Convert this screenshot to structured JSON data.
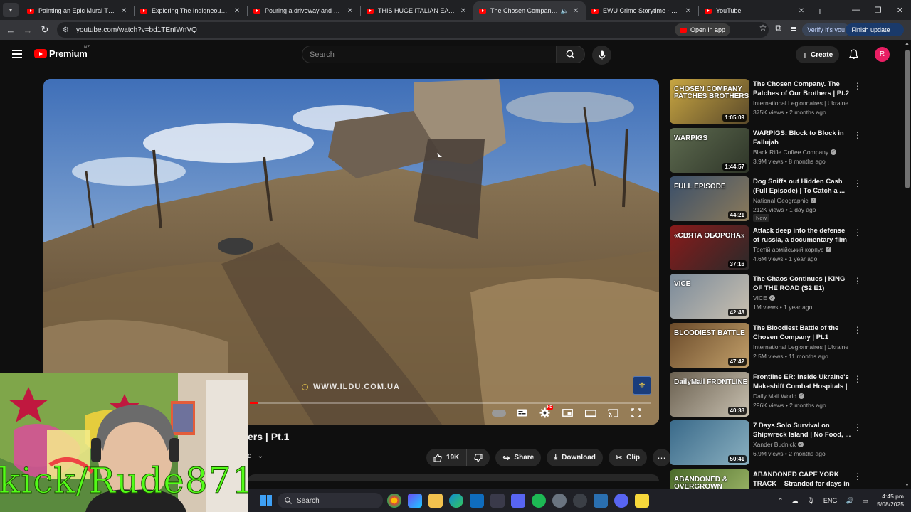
{
  "tabs": [
    {
      "label": "Painting an Epic Mural That Wi",
      "active": false
    },
    {
      "label": "Exploring The Indigneous Tribal",
      "active": false
    },
    {
      "label": "Pouring a driveway and WHAT",
      "active": false
    },
    {
      "label": "THIS HUGE ITALIAN EATING CH",
      "active": false
    },
    {
      "label": "The Chosen Company. The",
      "active": true
    },
    {
      "label": "EWU Crime Storytime - YouTub",
      "active": false
    },
    {
      "label": "YouTube",
      "active": false
    }
  ],
  "address": {
    "url": "youtube.com/watch?v=bd1TEnIWnVQ",
    "open_in_app": "Open in app",
    "verify": "Verify it's you",
    "finish_update": "Finish update"
  },
  "header": {
    "logo_text": "Premium",
    "country": "NZ",
    "search_placeholder": "Search",
    "create_label": "Create",
    "avatar_letter": "R"
  },
  "player": {
    "watermark": "WWW.ILDU.COM.UA",
    "progress": 0.02
  },
  "video": {
    "title_visible": "ers | Pt.1",
    "channel_tail": "d",
    "likes": "19K",
    "share_label": "Share",
    "download_label": "Download",
    "clip_label": "Clip"
  },
  "recommendations": [
    {
      "title": "The Chosen Company. The Patches of Our Brothers | Pt.2",
      "channel": "International Legionnaires | Ukraine",
      "verified": false,
      "meta": "375K views • 2 months ago",
      "duration": "1:05:09",
      "thumb_text": "CHOSEN COMPANY PATCHES BROTHERS",
      "badge": ""
    },
    {
      "title": "WARPIGS: Block to Block in Fallujah",
      "channel": "Black Rifle Coffee Company",
      "verified": true,
      "meta": "3.9M views • 8 months ago",
      "duration": "1:44:57",
      "thumb_text": "WARPIGS",
      "badge": ""
    },
    {
      "title": "Dog Sniffs out Hidden Cash (Full Episode) | To Catch a ...",
      "channel": "National Geographic",
      "verified": true,
      "meta": "212K views • 1 day ago",
      "duration": "44:21",
      "thumb_text": "FULL EPISODE",
      "badge": "New"
    },
    {
      "title": "Attack deep into the defense of russia, a documentary film ...",
      "channel": "Третій армійський корпус",
      "verified": true,
      "meta": "4.6M views • 1 year ago",
      "duration": "37:16",
      "thumb_text": "«СВЯТА ОБОРОНА»",
      "badge": ""
    },
    {
      "title": "The Chaos Continues | KING OF THE ROAD (S2 E1)",
      "channel": "VICE",
      "verified": true,
      "meta": "1M views • 1 year ago",
      "duration": "42:48",
      "thumb_text": "VICE",
      "badge": ""
    },
    {
      "title": "The Bloodiest Battle of the Chosen Company | Pt.1",
      "channel": "International Legionnaires | Ukraine",
      "verified": false,
      "meta": "2.5M views • 11 months ago",
      "duration": "47:42",
      "thumb_text": "BLOODIEST BATTLE",
      "badge": ""
    },
    {
      "title": "Frontline ER: Inside Ukraine's Makeshift Combat Hospitals | ...",
      "channel": "Daily Mail World",
      "verified": true,
      "meta": "296K views • 2 months ago",
      "duration": "40:38",
      "thumb_text": "DailyMail FRONTLINE",
      "badge": ""
    },
    {
      "title": "7 Days Solo Survival on Shipwreck Island | No Food, ...",
      "channel": "Xander Budnick",
      "verified": true,
      "meta": "6.9M views • 2 months ago",
      "duration": "50:41",
      "thumb_text": "",
      "badge": ""
    },
    {
      "title": "ABANDONED CAPE YORK TRACK – Stranded for days in ...",
      "channel": "",
      "verified": false,
      "meta": "",
      "duration": "",
      "thumb_text": "ABANDONED & OVERGROWN",
      "badge": ""
    }
  ],
  "overlay": {
    "stream_handle": "kick/Rude871"
  },
  "taskbar": {
    "search_label": "Search",
    "lang": "ENG",
    "time": "4:45 pm",
    "date": "5/08/2025"
  },
  "colors": {
    "yt_red": "#ff0000",
    "kick_green": "#53fc18",
    "background": "#0f0f0f"
  }
}
